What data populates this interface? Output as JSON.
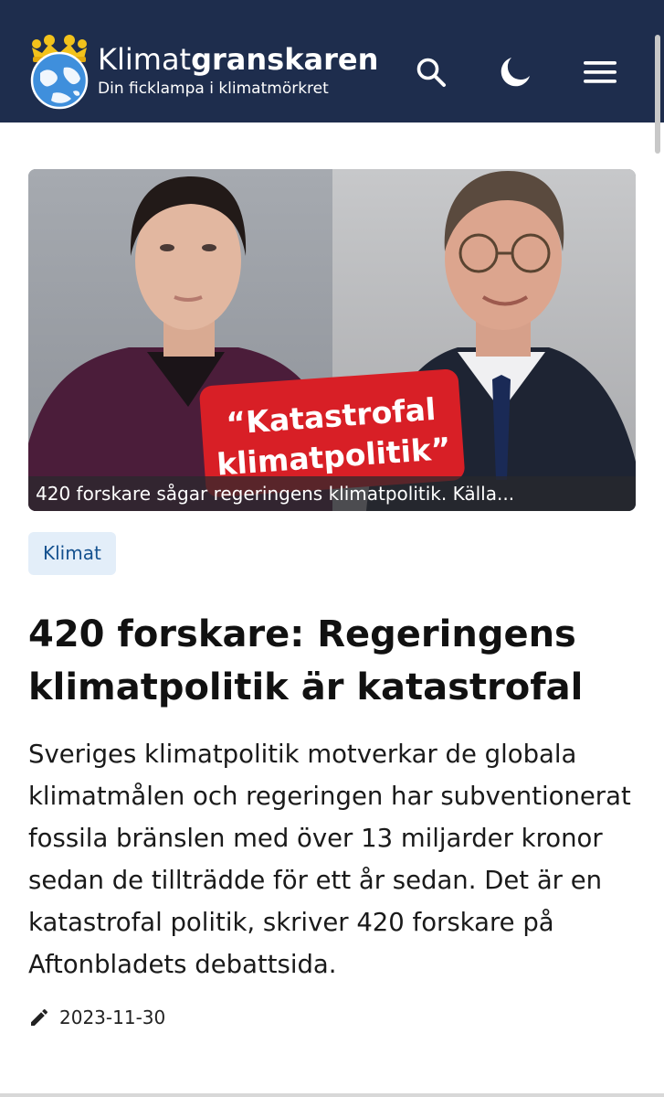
{
  "header": {
    "brand_light": "Klimat",
    "brand_bold": "granskaren",
    "tagline": "Din ficklampa i klimatmörkret",
    "background_color": "#1e2d4d",
    "icons": [
      "search-icon",
      "moon-icon",
      "hamburger-menu-icon"
    ]
  },
  "hero": {
    "overlay_line1": "“Katastrofal",
    "overlay_line2": "klimatpolitik”",
    "caption": "420 forskare sågar regeringens klimatpolitik. Källa..."
  },
  "article": {
    "category": "Klimat",
    "title": "420 forskare: Regeringens klimatpolitik är katastrofal",
    "lead": "Sveriges klimatpolitik motverkar de globala klimatmålen och regeringen har subventionerat fossila bränslen med över 13 miljarder kronor sedan de tillträdde för ett år sedan. Det är en katastrofal politik, skriver 420 forskare på Aftonbladets debattsida.",
    "date": "2023-11-30",
    "date_icon": "pencil-icon"
  },
  "colors": {
    "tag_background": "#e3eef9",
    "tag_text": "#14518f",
    "overlay_red": "#d81f26"
  }
}
